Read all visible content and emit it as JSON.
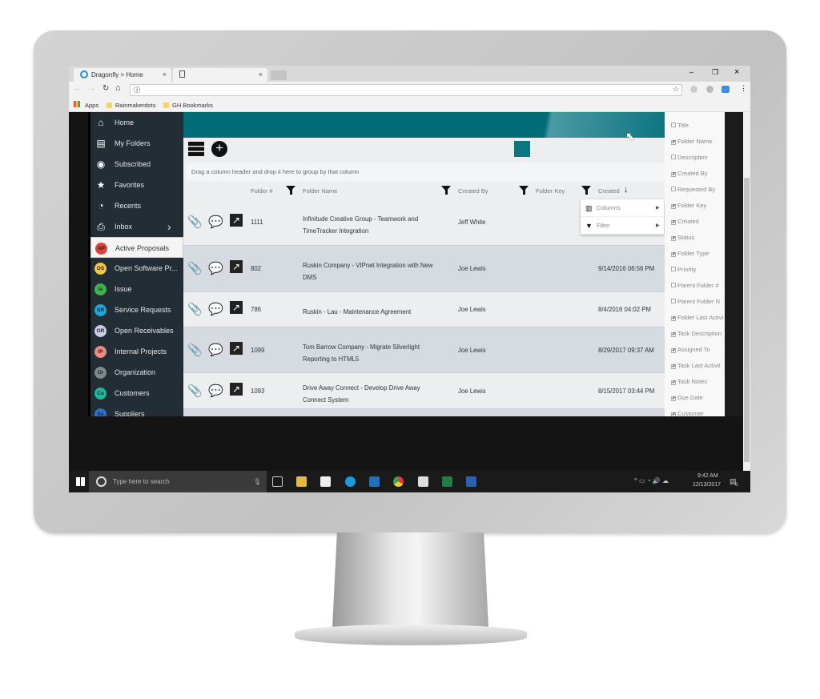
{
  "browser": {
    "tabs": [
      {
        "label": "Dragonfly > Home",
        "close": "×"
      },
      {
        "label": "",
        "close": "×"
      }
    ],
    "bookmarks": [
      "Apps",
      "Rainmakerdots",
      "GH Bookmarks"
    ],
    "window_controls": [
      "–",
      "❐",
      "×"
    ]
  },
  "sidebar": {
    "items": [
      {
        "label": "Home",
        "icon": "home-icon"
      },
      {
        "label": "My Folders",
        "icon": "clipboard-icon"
      },
      {
        "label": "Subscribed",
        "icon": "eye-icon"
      },
      {
        "label": "Favorites",
        "icon": "star-icon"
      },
      {
        "label": "Recents",
        "icon": "clock-icon"
      },
      {
        "label": "Inbox",
        "icon": "inbox-icon"
      },
      {
        "label": "Active Proposals",
        "badge": "AP",
        "color": "#d9433a"
      },
      {
        "label": "Open Software Pr...",
        "badge": "OS",
        "color": "#f0c64a"
      },
      {
        "label": "Issue",
        "badge": "Is",
        "color": "#3bb54a"
      },
      {
        "label": "Service Requests",
        "badge": "SR",
        "color": "#1fa4e0"
      },
      {
        "label": "Open Receivables",
        "badge": "OR",
        "color": "#c9cde8"
      },
      {
        "label": "Internal Projects",
        "badge": "IP",
        "color": "#f08a7e"
      },
      {
        "label": "Organization",
        "badge": "Or",
        "color": "#7b8a8c"
      },
      {
        "label": "Customers",
        "badge": "Cu",
        "color": "#1ab8a0"
      },
      {
        "label": "Suppliers",
        "badge": "Su",
        "color": "#2e6fd1"
      }
    ]
  },
  "grid": {
    "group_hint": "Drag a column header and drop it here to group by that column",
    "columns": [
      "Folder #",
      "Folder Name",
      "Created By",
      "Folder Key",
      "Created"
    ],
    "rows": [
      {
        "num": "1111",
        "name": [
          "Infinitude Creative Group - Teamwork and",
          "TimeTracker Integration"
        ],
        "created_by": "Jeff White",
        "created": ""
      },
      {
        "num": "802",
        "name": [
          "Ruskin Company - VIPnet Integration with New",
          "DMS"
        ],
        "created_by": "Joe Lewis",
        "created": "9/14/2016 06:56 PM"
      },
      {
        "num": "786",
        "name": [
          "Ruskin - Lau - Maintenance Agreement",
          ""
        ],
        "created_by": "Joe Lewis",
        "created": "8/4/2016 04:02 PM"
      },
      {
        "num": "1099",
        "name": [
          "Tom Barrow Company - Migrate Silverlight",
          "Reporting to HTML5"
        ],
        "created_by": "Joe Lewis",
        "created": "8/29/2017 09:37 AM"
      },
      {
        "num": "1093",
        "name": [
          "Drive Away Connect - Develop Drive Away",
          "Connect System"
        ],
        "created_by": "Joe Lewis",
        "created": "8/15/2017 03:44 PM"
      }
    ],
    "menu": [
      "Columns",
      "Filter"
    ]
  },
  "column_chooser": [
    {
      "label": "Title",
      "checked": false
    },
    {
      "label": "Folder Name",
      "checked": true
    },
    {
      "label": "Description",
      "checked": false
    },
    {
      "label": "Created By",
      "checked": true
    },
    {
      "label": "Requested By",
      "checked": false
    },
    {
      "label": "Folder Key",
      "checked": true
    },
    {
      "label": "Created",
      "checked": true
    },
    {
      "label": "Status",
      "checked": true
    },
    {
      "label": "Folder Type",
      "checked": true
    },
    {
      "label": "Priority",
      "checked": false
    },
    {
      "label": "Parent Folder #",
      "checked": false
    },
    {
      "label": "Parent Folder N",
      "checked": false
    },
    {
      "label": "Folder Last Activi",
      "checked": true
    },
    {
      "label": "Task Description",
      "checked": true
    },
    {
      "label": "Assigned To",
      "checked": true
    },
    {
      "label": "Task Last Activit",
      "checked": true
    },
    {
      "label": "Task Notes",
      "checked": true
    },
    {
      "label": "Due Date",
      "checked": true
    },
    {
      "label": "Customer",
      "checked": true
    }
  ],
  "taskbar": {
    "search_placeholder": "Type here to search",
    "time": "9:42 AM",
    "date": "12/13/2017",
    "notifications": "6"
  },
  "colors": {
    "teal": "#006d78",
    "sidebar": "#222d35"
  }
}
